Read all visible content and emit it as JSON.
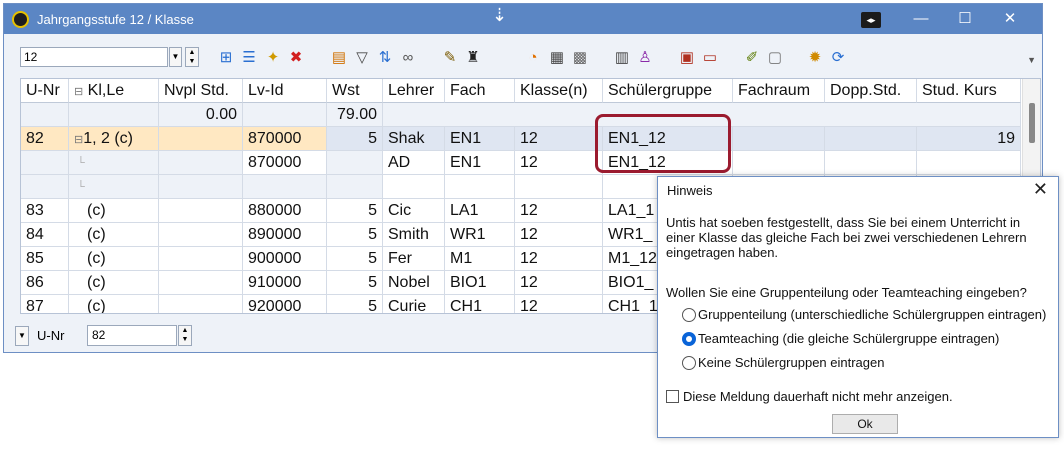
{
  "window": {
    "title": "Jahrgangsstufe 12 / Klasse"
  },
  "toolbar": {
    "combo_value": "12",
    "icons": [
      "add-row-icon",
      "list-icon",
      "new-icon",
      "delete-icon",
      "filter-icon",
      "funnel-icon",
      "sort-icon",
      "link-icon",
      "magic-icon",
      "graduate-icon",
      "clock-icon",
      "calendar-icon",
      "grid-icon",
      "columns-icon",
      "people-icon",
      "print-icon",
      "monitor-icon",
      "edit-icon",
      "document-icon",
      "gear-icon",
      "refresh-icon"
    ]
  },
  "grid": {
    "columns": [
      "U-Nr",
      "Kl,Le",
      "Nvpl Std.",
      "Lv-Id",
      "Wst",
      "Lehrer",
      "Fach",
      "Klasse(n)",
      "Schülergruppe",
      "Fachraum",
      "Dopp.Std.",
      "Stud. Kurs"
    ],
    "totals": {
      "nvpl": "0.00",
      "wst": "79.00"
    },
    "rows": [
      {
        "unr": "82",
        "klle": "1, 2 (c)",
        "lvid": "870000",
        "wst": "5",
        "lehrer": "Shak",
        "fach": "EN1",
        "klasse": "12",
        "gruppe": "EN1_12",
        "kurs": "19"
      },
      {
        "unr": "",
        "klle": "",
        "lvid": "870000",
        "wst": "",
        "lehrer": "AD",
        "fach": "EN1",
        "klasse": "12",
        "gruppe": "EN1_12",
        "kurs": ""
      },
      {
        "unr": "",
        "klle": "",
        "lvid": "",
        "wst": "",
        "lehrer": "",
        "fach": "",
        "klasse": "",
        "gruppe": "",
        "kurs": ""
      },
      {
        "unr": "83",
        "klle": "(c)",
        "lvid": "880000",
        "wst": "5",
        "lehrer": "Cic",
        "fach": "LA1",
        "klasse": "12",
        "gruppe": "LA1_1",
        "kurs": ""
      },
      {
        "unr": "84",
        "klle": "(c)",
        "lvid": "890000",
        "wst": "5",
        "lehrer": "Smith",
        "fach": "WR1",
        "klasse": "12",
        "gruppe": "WR1_",
        "kurs": ""
      },
      {
        "unr": "85",
        "klle": "(c)",
        "lvid": "900000",
        "wst": "5",
        "lehrer": "Fer",
        "fach": "M1",
        "klasse": "12",
        "gruppe": "M1_12",
        "kurs": ""
      },
      {
        "unr": "86",
        "klle": "(c)",
        "lvid": "910000",
        "wst": "5",
        "lehrer": "Nobel",
        "fach": "BIO1",
        "klasse": "12",
        "gruppe": "BIO1_",
        "kurs": ""
      },
      {
        "unr": "87",
        "klle": "(c)",
        "lvid": "920000",
        "wst": "5",
        "lehrer": "Curie",
        "fach": "CH1",
        "klasse": "12",
        "gruppe": "CH1_1",
        "kurs": ""
      }
    ]
  },
  "bottom": {
    "label": "U-Nr",
    "value": "82"
  },
  "dialog": {
    "title": "Hinweis",
    "message": "Untis hat soeben festgestellt, dass Sie bei einem Unterricht in einer Klasse das gleiche Fach bei zwei verschiedenen Lehrern eingetragen haben.",
    "question": "Wollen Sie eine Gruppenteilung oder Teamteaching eingeben?",
    "options": [
      "Gruppenteilung (unterschiedliche Schülergruppen eintragen)",
      "Teamteaching (die gleiche Schülergruppe eintragen)",
      "Keine Schülergruppen eintragen"
    ],
    "selected_option": 1,
    "checkbox_label": "Diese Meldung dauerhaft nicht mehr anzeigen.",
    "ok_label": "Ok"
  },
  "colors": {
    "titlebar": "#5b86c4",
    "highlight_border": "#9b1b2f",
    "selected_row": "#dfe6f2",
    "orange_cell": "#ffe8c2"
  }
}
